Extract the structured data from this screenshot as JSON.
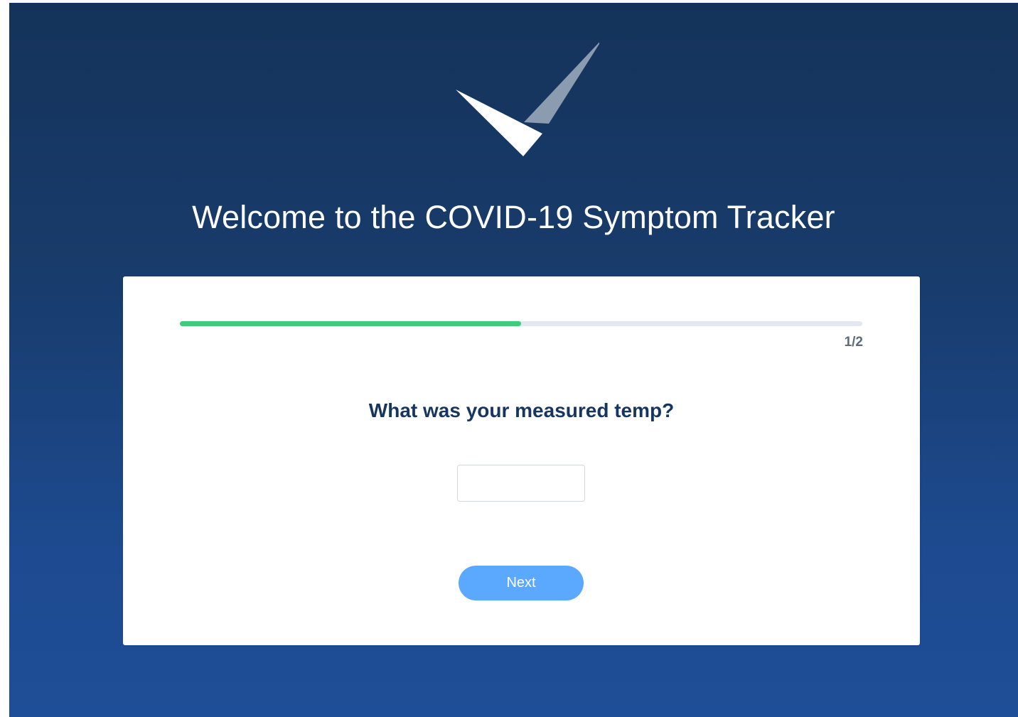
{
  "header": {
    "title": "Welcome to the COVID-19 Symptom Tracker",
    "logo_icon": "checkmark-logo-icon"
  },
  "progress": {
    "fraction": 0.5,
    "step_label": "1/2",
    "fill_color": "#3ecb7a",
    "track_color": "#e3e8f0"
  },
  "form": {
    "question": "What was your measured temp?",
    "temp_value": "",
    "temp_placeholder": "",
    "next_label": "Next",
    "next_color": "#5aa9ff"
  },
  "colors": {
    "background_top": "#15335a",
    "background_bottom": "#1f4e98",
    "heading": "#17365f"
  }
}
